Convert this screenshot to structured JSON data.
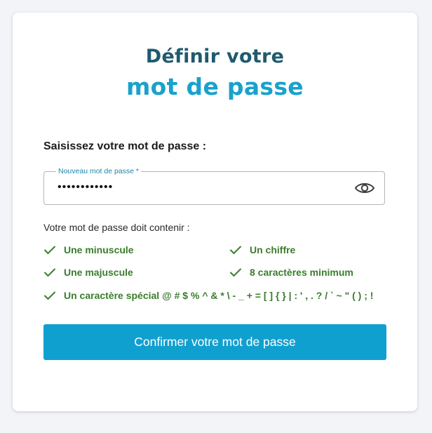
{
  "header": {
    "title_line1": "Définir votre",
    "title_line2": "mot de passe"
  },
  "form": {
    "section_label": "Saisissez votre mot de passe :",
    "password_field": {
      "label": "Nouveau mot de passe *",
      "value": "••••••••••••",
      "toggle_icon": "eye-icon"
    },
    "rules_intro": "Votre mot de passe doit contenir :",
    "rules": [
      {
        "label": "Une minuscule",
        "status": "met"
      },
      {
        "label": "Un chiffre",
        "status": "met"
      },
      {
        "label": "Une majuscule",
        "status": "met"
      },
      {
        "label": "8 caractères minimum",
        "status": "met"
      },
      {
        "label": "Un caractère spécial @ # $ % ^ & * \\ - _ + = [ ] { } | : ' , . ? / ` ~ \" ( ) ; !",
        "status": "met"
      }
    ],
    "submit_label": "Confirmer votre mot de passe"
  },
  "colors": {
    "page_background": "#f3f4f8",
    "title_dark": "#1f5a6e",
    "title_accent": "#18a2cc",
    "rule_met": "#3a7d2c",
    "button": "#10a0cf"
  }
}
